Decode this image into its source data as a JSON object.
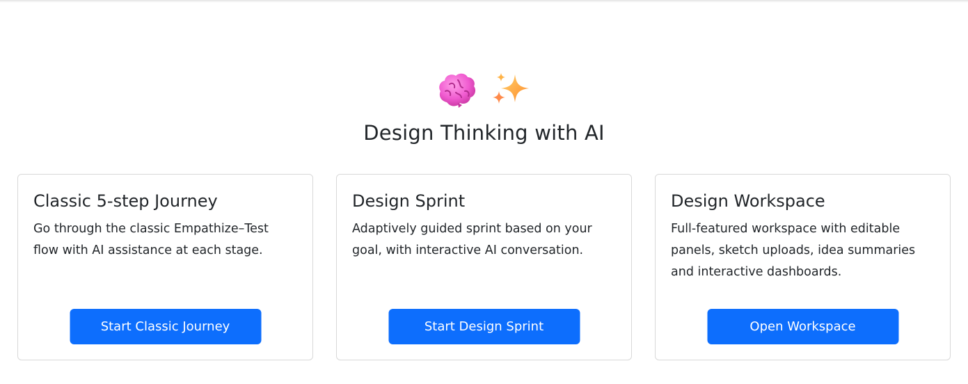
{
  "header": {
    "icons": [
      "brain-icon",
      "sparkles-icon"
    ],
    "title": "Design Thinking with AI"
  },
  "cards": [
    {
      "title": "Classic 5-step Journey",
      "description": "Go through the classic Empathize–Test flow with AI assistance at each stage.",
      "button_label": "Start Classic Journey"
    },
    {
      "title": "Design Sprint",
      "description": "Adaptively guided sprint based on your goal, with interactive AI conversation.",
      "button_label": "Start Design Sprint"
    },
    {
      "title": "Design Workspace",
      "description": "Full-featured workspace with editable panels, sketch uploads, idea summaries and interactive dashboards.",
      "button_label": "Open Workspace"
    }
  ],
  "colors": {
    "primary_button": "#0d6efd",
    "card_border": "#d8d8d8",
    "text": "#212529",
    "brain": "#f06ad0",
    "sparkle": "#ffa93a"
  }
}
